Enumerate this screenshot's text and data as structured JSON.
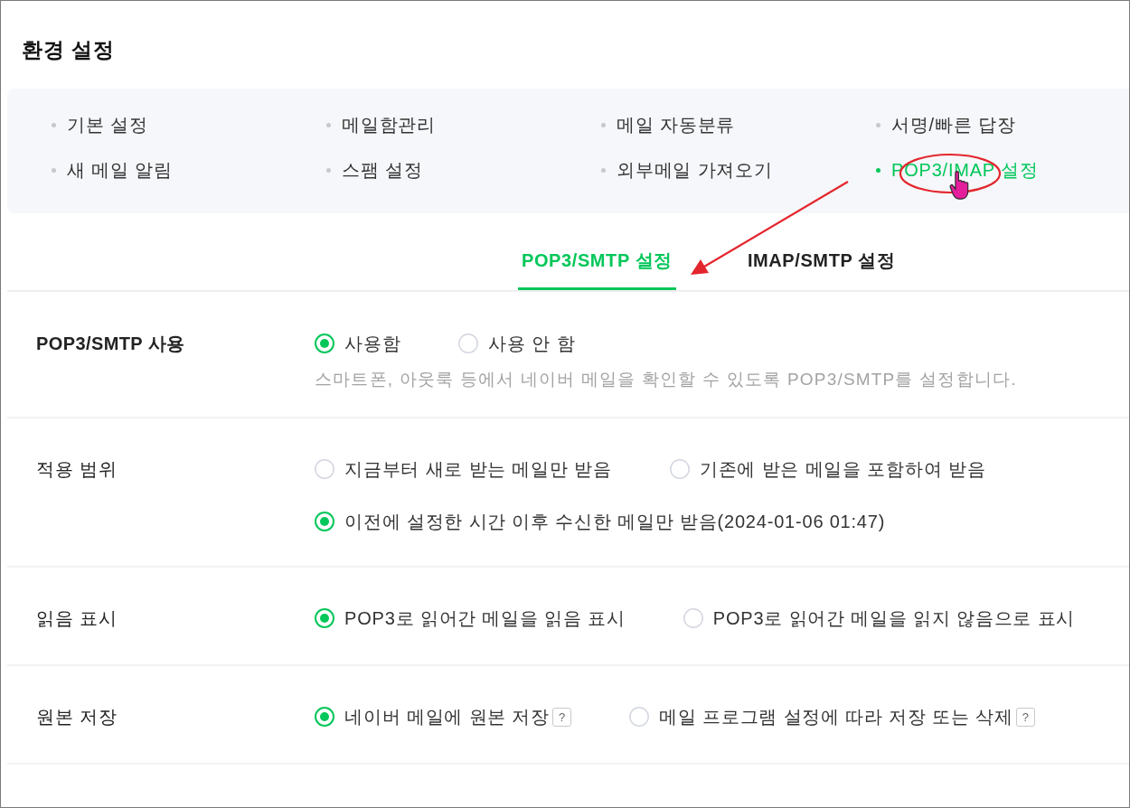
{
  "page": {
    "title": "환경 설정"
  },
  "menu": [
    {
      "label": "기본 설정",
      "selected": false
    },
    {
      "label": "메일함관리",
      "selected": false
    },
    {
      "label": "메일 자동분류",
      "selected": false
    },
    {
      "label": "서명/빠른 답장",
      "selected": false
    },
    {
      "label": "새 메일 알림",
      "selected": false
    },
    {
      "label": "스팸 설정",
      "selected": false
    },
    {
      "label": "외부메일 가져오기",
      "selected": false
    },
    {
      "label": "POP3/IMAP 설정",
      "selected": true
    }
  ],
  "tabs": [
    {
      "label": "POP3/SMTP 설정",
      "selected": true
    },
    {
      "label": "IMAP/SMTP 설정",
      "selected": false
    }
  ],
  "settings": [
    {
      "label": "POP3/SMTP 사용",
      "strong": true,
      "lines": [
        [
          {
            "label": "사용함",
            "selected": true
          },
          {
            "label": "사용 안 함",
            "selected": false
          }
        ]
      ],
      "description": "스마트폰, 아웃룩 등에서 네이버 메일을 확인할 수 있도록 POP3/SMTP를 설정합니다."
    },
    {
      "label": "적용 범위",
      "strong": false,
      "lines": [
        [
          {
            "label": "지금부터 새로 받는 메일만 받음",
            "selected": false
          },
          {
            "label": "기존에 받은 메일을 포함하여 받음",
            "selected": false
          }
        ],
        [
          {
            "label": "이전에 설정한 시간 이후 수신한 메일만 받음(2024-01-06 01:47)",
            "selected": true
          }
        ]
      ]
    },
    {
      "label": "읽음 표시",
      "strong": false,
      "lines": [
        [
          {
            "label": "POP3로 읽어간 메일을 읽음 표시",
            "selected": true
          },
          {
            "label": "POP3로 읽어간 메일을 읽지 않음으로 표시",
            "selected": false
          }
        ]
      ]
    },
    {
      "label": "원본 저장",
      "strong": false,
      "lines": [
        [
          {
            "label": "네이버 메일에 원본 저장",
            "selected": true,
            "help": "?"
          },
          {
            "label": "메일 프로그램 설정에 따라 저장 또는 삭제",
            "selected": false,
            "help": "?"
          }
        ]
      ]
    }
  ]
}
